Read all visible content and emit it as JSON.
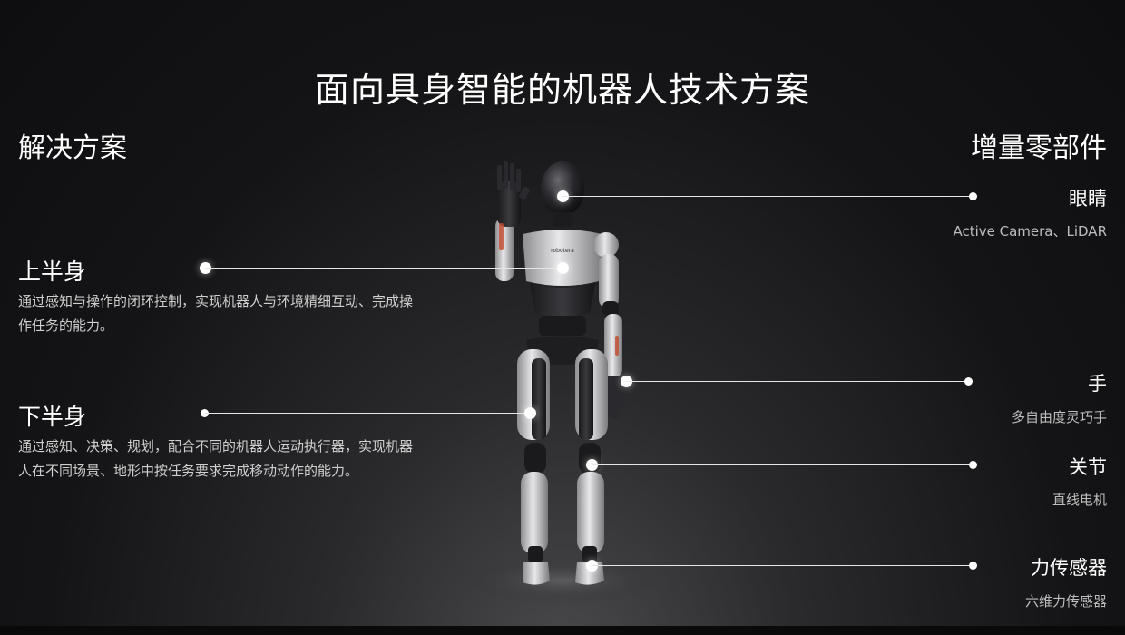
{
  "title": "面向具身智能的机器人技术方案",
  "left_heading": "解决方案",
  "right_heading": "增量零部件",
  "robot_brand": "robotera",
  "solutions": [
    {
      "title": "上半身",
      "desc": "通过感知与操作的闭环控制，实现机器人与环境精细互动、完成操作任务的能力。"
    },
    {
      "title": "下半身",
      "desc": "通过感知、决策、规划，配合不同的机器人运动执行器，实现机器人在不同场景、地形中按任务要求完成移动动作的能力。"
    }
  ],
  "parts": [
    {
      "title": "眼睛",
      "sub": "Active Camera、LiDAR"
    },
    {
      "title": "手",
      "sub": "多自由度灵巧手"
    },
    {
      "title": "关节",
      "sub": "直线电机"
    },
    {
      "title": "力传感器",
      "sub": "六维力传感器"
    }
  ]
}
